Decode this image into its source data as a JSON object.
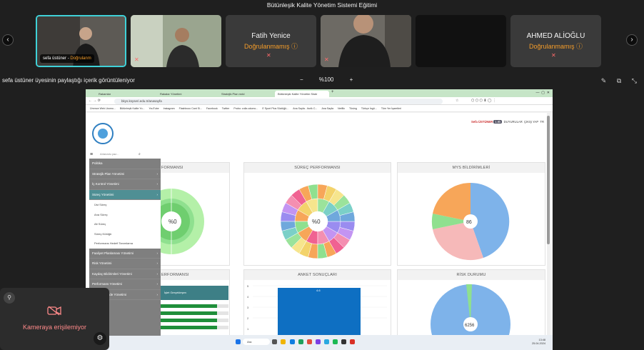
{
  "meeting": {
    "title": "Bütünleşik Kalite Yönetim Sistemi Eğitimi",
    "participants": [
      {
        "name": "sefa üstüner",
        "status": "Doğrulanm"
      },
      {
        "name": "",
        "status": ""
      },
      {
        "name": "Fatih Yenice",
        "status": "Doğrulanmamış"
      },
      {
        "name": "",
        "status": ""
      },
      {
        "name": "",
        "status": ""
      },
      {
        "name": "AHMED ALİOĞLU",
        "status": "Doğrulanmamış"
      }
    ]
  },
  "share": {
    "label": "sefa üstüner üyesinin paylaştığı içerik görüntüleniyor",
    "zoom_minus": "−",
    "zoom_value": "%100",
    "zoom_plus": "+"
  },
  "camera": {
    "message": "Kameraya erişilemiyor"
  },
  "browser": {
    "tabs": [
      "Rakamlar",
      "Rakalar Yönetimi",
      "Stratejik Plan mıtd",
      "Bütünleşik Kalite Yönetim Siste"
    ],
    "address": "bkys.ksyseri.edu.tr/anasayfa",
    "bookmarks": [
      "Ümrnce Web Lbomo...",
      "Bütünleşik Kalite Yo...",
      "YouTube",
      "Instagram",
      "Flashbcoo Cant Si...",
      "Facebook",
      "Twitter",
      "Probo: zulla odumo...",
      "E Sport Plus Sözlüğü...",
      "Ana Sayfa - Iturlk C...",
      "Ana Sayfa",
      "Netflix",
      "Tüsing",
      "Türkçe İngü...",
      "Tüm Yer İşaretleri"
    ]
  },
  "app": {
    "user": "Sefa ÜSTÜNER",
    "user_badge": "1.8k",
    "duyurular": "DUYURULAR",
    "exit": "ÇIKIŞ YAP",
    "lang": "TR",
    "search_placeholder": "Arlanaılu yaz...",
    "menu": [
      {
        "label": "Politika",
        "arrow": false
      },
      {
        "label": "Stratejik Plan Yönetimi",
        "arrow": true
      },
      {
        "label": "İç Kontrol Yönetimi",
        "arrow": true
      },
      {
        "label": "Süreç Yönetimi",
        "arrow": true,
        "selected": true
      },
      {
        "label": "Üst Süreç",
        "sub": true
      },
      {
        "label": "Ana Süreç",
        "sub": true
      },
      {
        "label": "Alt Süreç",
        "sub": true
      },
      {
        "label": "Süreç Kütüğü",
        "sub": true
      },
      {
        "label": "Performans Hedefi Tanımlama",
        "sub": true
      },
      {
        "label": "Faaliyet Planlaması Yönetimi",
        "arrow": true
      },
      {
        "label": "Risk Yönetimi",
        "arrow": true
      },
      {
        "label": "Kaydaç Bildirimleri Yönetimi",
        "arrow": true
      },
      {
        "label": "Performans Yönetimi",
        "arrow": true
      },
      {
        "label": "Faaliyetlerinde Yönetimi",
        "arrow": true
      }
    ],
    "cards": {
      "c1": "FORMANSI",
      "c2": "SÜREÇ PERFORMANSI",
      "c3": "MYS BİLDİRİMLERİ",
      "c4": "ERFORMANSI",
      "c5": "ANKET SONUÇLARI",
      "c6": "RİSK DURUMU"
    },
    "donut1_center": "%0",
    "donut2_center": "%0",
    "pie1_center": "86",
    "pie2_center": "6256",
    "bar_header": "İşlet Gerçekleşen",
    "anket_bar_label": "4.6",
    "anket_y_ticks": [
      "5",
      "4",
      "3",
      "2",
      "1"
    ]
  },
  "taskbar": {
    "search": "Ara",
    "time": "13:48",
    "date": "25.04.2024",
    "weather": "24°C"
  },
  "colors": {
    "accent": "#3fd1d8",
    "warning": "#f59d2a",
    "green": "#8fe08f",
    "blue": "#7eb3ea"
  }
}
